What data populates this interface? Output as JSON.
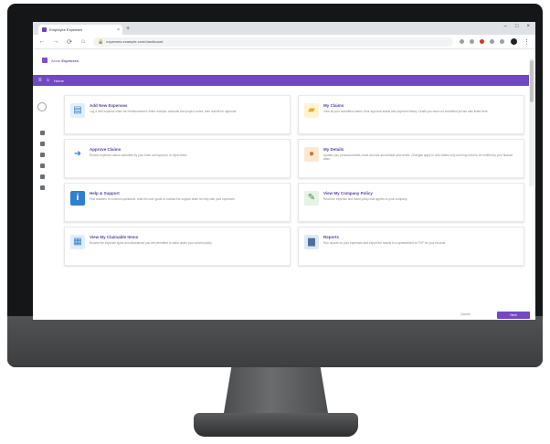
{
  "browser": {
    "tab_title": "Employee Expenses",
    "tab_close": "×",
    "new_tab": "+",
    "window_controls": [
      "–",
      "□",
      "×"
    ],
    "nav": {
      "back": "←",
      "forward": "→",
      "reload": "⟳",
      "home": "⌂"
    },
    "url": "expenses.example.com/dashboard",
    "lock_icon": "🔒",
    "menu": "⋮",
    "extension_colors": [
      "#9aa0a6",
      "#9aa0a6",
      "#d93025",
      "#9aa0a6",
      "#9aa0a6"
    ]
  },
  "app": {
    "name_prefix": "Acme",
    "name_bold": "Expenses",
    "brand_color": "#7247c4",
    "bar_menu_icon": "≡",
    "bar_home_icon": "⌂",
    "bar_title": "Home"
  },
  "cards": [
    {
      "icon": "claim-form-icon",
      "glyph": "▤",
      "style": "ic-blue",
      "title": "Add New Expenses",
      "desc": "Log a new expense claim for reimbursement. Enter receipts, amounts and project codes, then submit for approval."
    },
    {
      "icon": "folder-icon",
      "glyph": "▰",
      "style": "ic-folder",
      "title": "My Claims",
      "desc": "View all your submitted claims, their approval status and payment history. Drafts you have not submitted yet are also listed here."
    },
    {
      "icon": "arrow-icon",
      "glyph": "➜",
      "style": "ic-arrow",
      "title": "Approve Claims",
      "desc": "Review expense claims submitted by your team and approve or reject them."
    },
    {
      "icon": "person-icon",
      "glyph": "●",
      "style": "ic-person",
      "title": "My Details",
      "desc": "Update your personal details, bank account and default cost centre. Changes apply to new claims only and may need to be verified by your finance team."
    },
    {
      "icon": "info-icon",
      "glyph": "i",
      "style": "ic-info",
      "title": "Help & Support",
      "desc": "Find answers to common questions, read the user guide or contact the support team for help with your expenses."
    },
    {
      "icon": "policy-document-icon",
      "glyph": "✎",
      "style": "ic-doc",
      "title": "View My Company Policy",
      "desc": "Read the expense and travel policy that applies to your company."
    },
    {
      "icon": "summary-icon",
      "glyph": "▦",
      "style": "ic-sum",
      "title": "View My Claimable Items",
      "desc": "Browse the expense types and allowances you are permitted to claim under your current policy."
    },
    {
      "icon": "report-icon",
      "glyph": "▆",
      "style": "ic-report",
      "title": "Reports",
      "desc": "Run reports on your expenses and export the results to a spreadsheet or PDF for your records."
    }
  ],
  "footer": {
    "secondary_label": "Cancel",
    "primary_label": "Next"
  }
}
